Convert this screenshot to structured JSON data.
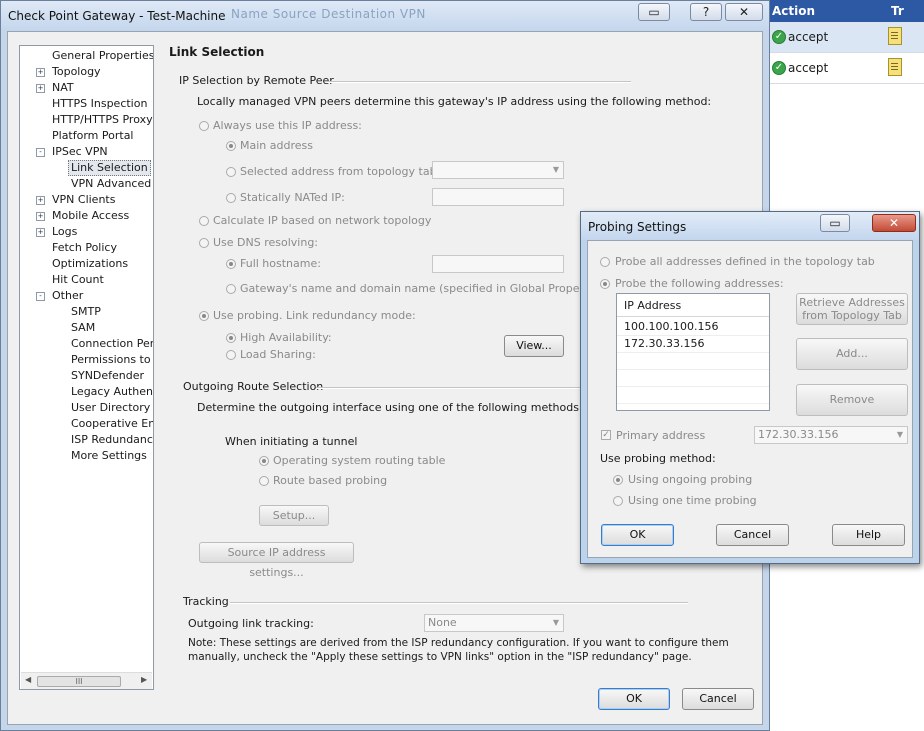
{
  "background_table": {
    "col_action": "Action",
    "col_track": "Tr",
    "rows": [
      {
        "action": "accept"
      },
      {
        "action": "accept"
      }
    ]
  },
  "main_window": {
    "title": "Check Point Gateway - Test-Machine",
    "ghost_headers": "Name          Source          Destination          VPN",
    "tree": [
      {
        "label": "General Properties",
        "expander": ""
      },
      {
        "label": "Topology",
        "expander": "+"
      },
      {
        "label": "NAT",
        "expander": "+"
      },
      {
        "label": "HTTPS Inspection",
        "expander": ""
      },
      {
        "label": "HTTP/HTTPS Proxy",
        "expander": ""
      },
      {
        "label": "Platform Portal",
        "expander": ""
      },
      {
        "label": "IPSec VPN",
        "expander": "-"
      },
      {
        "label": "Link Selection",
        "expander": ""
      },
      {
        "label": "VPN Advanced",
        "expander": ""
      },
      {
        "label": "VPN Clients",
        "expander": "+"
      },
      {
        "label": "Mobile Access",
        "expander": "+"
      },
      {
        "label": "Logs",
        "expander": "+"
      },
      {
        "label": "Fetch Policy",
        "expander": ""
      },
      {
        "label": "Optimizations",
        "expander": ""
      },
      {
        "label": "Hit Count",
        "expander": ""
      },
      {
        "label": "Other",
        "expander": "-"
      },
      {
        "label": "SMTP",
        "expander": ""
      },
      {
        "label": "SAM",
        "expander": ""
      },
      {
        "label": "Connection Persist",
        "expander": ""
      },
      {
        "label": "Permissions to Insta",
        "expander": ""
      },
      {
        "label": "SYNDefender",
        "expander": ""
      },
      {
        "label": "Legacy Authentica",
        "expander": ""
      },
      {
        "label": "User Directory",
        "expander": ""
      },
      {
        "label": "Cooperative Enforc",
        "expander": ""
      },
      {
        "label": "ISP Redundancy",
        "expander": ""
      },
      {
        "label": "More Settings",
        "expander": ""
      }
    ],
    "tree_scroll_thumb": "III",
    "page_title": "Link Selection",
    "ip_selection": {
      "group_label": "IP Selection by Remote Peer",
      "description": "Locally managed VPN peers determine this gateway's IP address using the following method:",
      "always_use": "Always use this IP address:",
      "main_address": "Main address",
      "selected_from_topology": "Selected address from topology table:",
      "statically_nated": "Statically NATed IP:",
      "calculate_ip": "Calculate IP based on network topology",
      "use_dns": "Use DNS resolving:",
      "full_hostname": "Full hostname:",
      "gateway_domain": "Gateway's name and domain name (specified in Global Properties)",
      "use_probing": "Use probing. Link redundancy mode:",
      "high_availability": "High Availability:",
      "load_sharing": "Load Sharing:",
      "view_button": "View..."
    },
    "outgoing": {
      "group_label": "Outgoing Route Selection",
      "description": "Determine the outgoing interface using one of the following methods:",
      "when_initiating": "When initiating a tunnel",
      "os_routing": "Operating system routing table",
      "route_probing": "Route based probing",
      "setup_button": "Setup...",
      "source_ip_button": "Source IP address settings..."
    },
    "tracking": {
      "group_label": "Tracking",
      "outgoing_tracking_label": "Outgoing link tracking:",
      "outgoing_tracking_value": "None",
      "note_line1": "Note: These settings are derived from the ISP redundancy configuration. If you want to configure them",
      "note_line2": "manually, uncheck the \"Apply these settings to VPN links\" option in the \"ISP redundancy\" page."
    },
    "ok_button": "OK",
    "cancel_button": "Cancel"
  },
  "probing_dialog": {
    "title": "Probing Settings",
    "probe_all": "Probe all addresses defined in the topology tab",
    "probe_following": "Probe the following addresses:",
    "list_header": "IP Address",
    "addresses": [
      "100.100.100.156",
      "172.30.33.156"
    ],
    "retrieve_button_line1": "Retrieve Addresses",
    "retrieve_button_line2": "from Topology Tab",
    "add_button": "Add...",
    "remove_button": "Remove",
    "primary_address_label": "Primary address",
    "primary_address_value": "172.30.33.156",
    "use_probing_method": "Use probing method:",
    "ongoing_probing": "Using ongoing probing",
    "one_time_probing": "Using one time probing",
    "ok_button": "OK",
    "cancel_button": "Cancel",
    "help_button": "Help"
  }
}
